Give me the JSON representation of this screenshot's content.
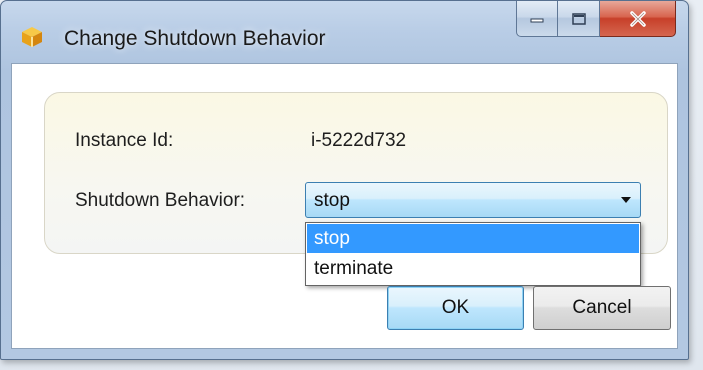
{
  "window": {
    "title": "Change Shutdown Behavior",
    "icon": "package-icon",
    "caption_buttons": [
      "minimize-icon",
      "maximize-icon",
      "close-icon"
    ]
  },
  "form": {
    "instance_id_label": "Instance Id:",
    "instance_id_value": "i-5222d732",
    "shutdown_label": "Shutdown Behavior:",
    "shutdown_value": "stop"
  },
  "dropdown": {
    "options": [
      "stop",
      "terminate"
    ],
    "selected": "stop"
  },
  "buttons": {
    "ok": "OK",
    "cancel": "Cancel"
  },
  "colors": {
    "selection": "#3399ff",
    "close_button": "#c7402a",
    "panel_background": "#fbf8e4"
  }
}
